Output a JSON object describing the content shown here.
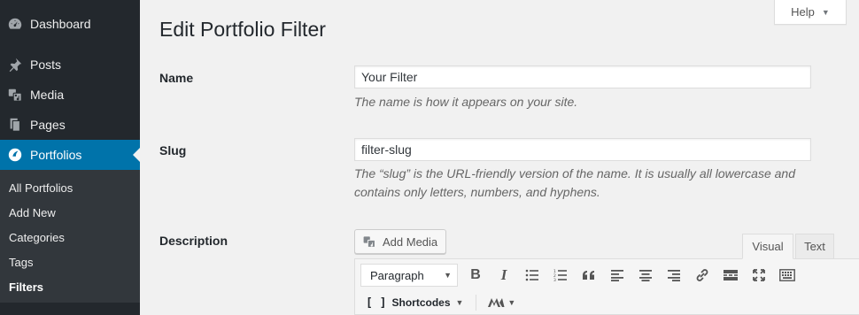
{
  "sidebar": {
    "menu": [
      {
        "label": "Dashboard",
        "icon": "dashboard-icon"
      },
      {
        "label": "Posts",
        "icon": "pin-icon"
      },
      {
        "label": "Media",
        "icon": "media-icon"
      },
      {
        "label": "Pages",
        "icon": "pages-icon"
      },
      {
        "label": "Portfolios",
        "icon": "portfolio-icon",
        "current": true
      }
    ],
    "submenu": [
      {
        "label": "All Portfolios"
      },
      {
        "label": "Add New"
      },
      {
        "label": "Categories"
      },
      {
        "label": "Tags"
      },
      {
        "label": "Filters",
        "current": true
      }
    ]
  },
  "help": {
    "label": "Help"
  },
  "page": {
    "title": "Edit Portfolio Filter"
  },
  "form": {
    "name_label": "Name",
    "name_value": "Your Filter",
    "name_desc": "The name is how it appears on your site.",
    "slug_label": "Slug",
    "slug_value": "filter-slug",
    "slug_desc_1": "The “slug” is the URL-friendly version of the name. It is usually all lowercase and",
    "slug_desc_2": "contains only letters, numbers, and hyphens.",
    "description_label": "Description"
  },
  "editor": {
    "add_media": "Add Media",
    "tab_visual": "Visual",
    "tab_text": "Text",
    "format_value": "Paragraph",
    "shortcodes_label": "Shortcodes"
  },
  "colors": {
    "sidebar_bg": "#23282d",
    "accent": "#0073aa",
    "page_bg": "#f1f1f1"
  }
}
